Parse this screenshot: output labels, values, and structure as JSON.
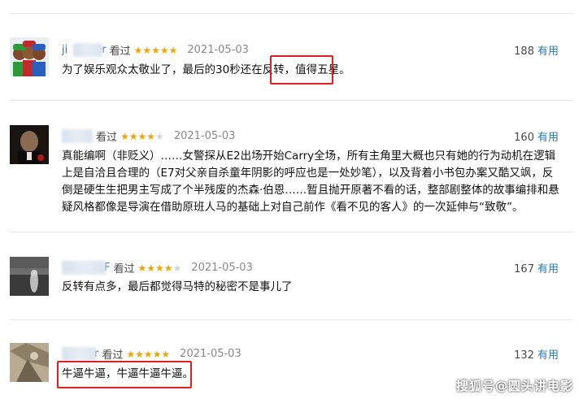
{
  "ui": {
    "watched_label": "看过",
    "useful_label": "有用",
    "star_color": "#f0a500",
    "highlight_color": "#e02020",
    "link_color": "#3377aa"
  },
  "reviews": [
    {
      "user_prefix": "ji",
      "user_suffix": "er",
      "stars": 5,
      "stars_text": "★★★★★",
      "date": "2021-05-03",
      "votes": "188",
      "content": "为了娱乐观众太敬业了，最后的30秒还在反转，值得五星。",
      "highlight": "值得五星。"
    },
    {
      "user_prefix": "",
      "user_suffix": "",
      "stars": 4,
      "stars_text": "★★★★",
      "stars_off": "★",
      "date": "2021-05-03",
      "votes": "160",
      "content": "真能编啊（非贬义）……女警探从E2出场开始Carry全场，所有主角里大概也只有她的行为动机在逻辑上是自洽且合理的（E7对父亲自杀童年阴影的呼应也是一处妙笔），以及背着小书包办案又酷又飒，反倒是硬生生把男主写成了个半残废的杰森·伯恩……暂且抛开原著不看的话，整部剧整体的故事编排和悬疑风格都像是导演在借助原班人马的基础上对自己前作《看不见的客人》的一次延伸与“致敬”。"
    },
    {
      "user_prefix": "",
      "user_suffix": "F",
      "stars": 4,
      "stars_text": "★★★★",
      "stars_off": "★",
      "date": "2021-05-03",
      "votes": "167",
      "content": "反转有点多，最后都觉得马特的秘密不是事儿了"
    },
    {
      "user_prefix": "",
      "user_suffix": "r",
      "stars": 5,
      "stars_text": "★★★★★",
      "date": "2021-05-03",
      "votes": "132",
      "content": "牛逼牛逼，牛逼牛逼牛逼。",
      "highlight": "牛逼牛逼，牛逼牛逼牛逼。"
    }
  ],
  "watermark": "搜狐号@圆头讲电影"
}
